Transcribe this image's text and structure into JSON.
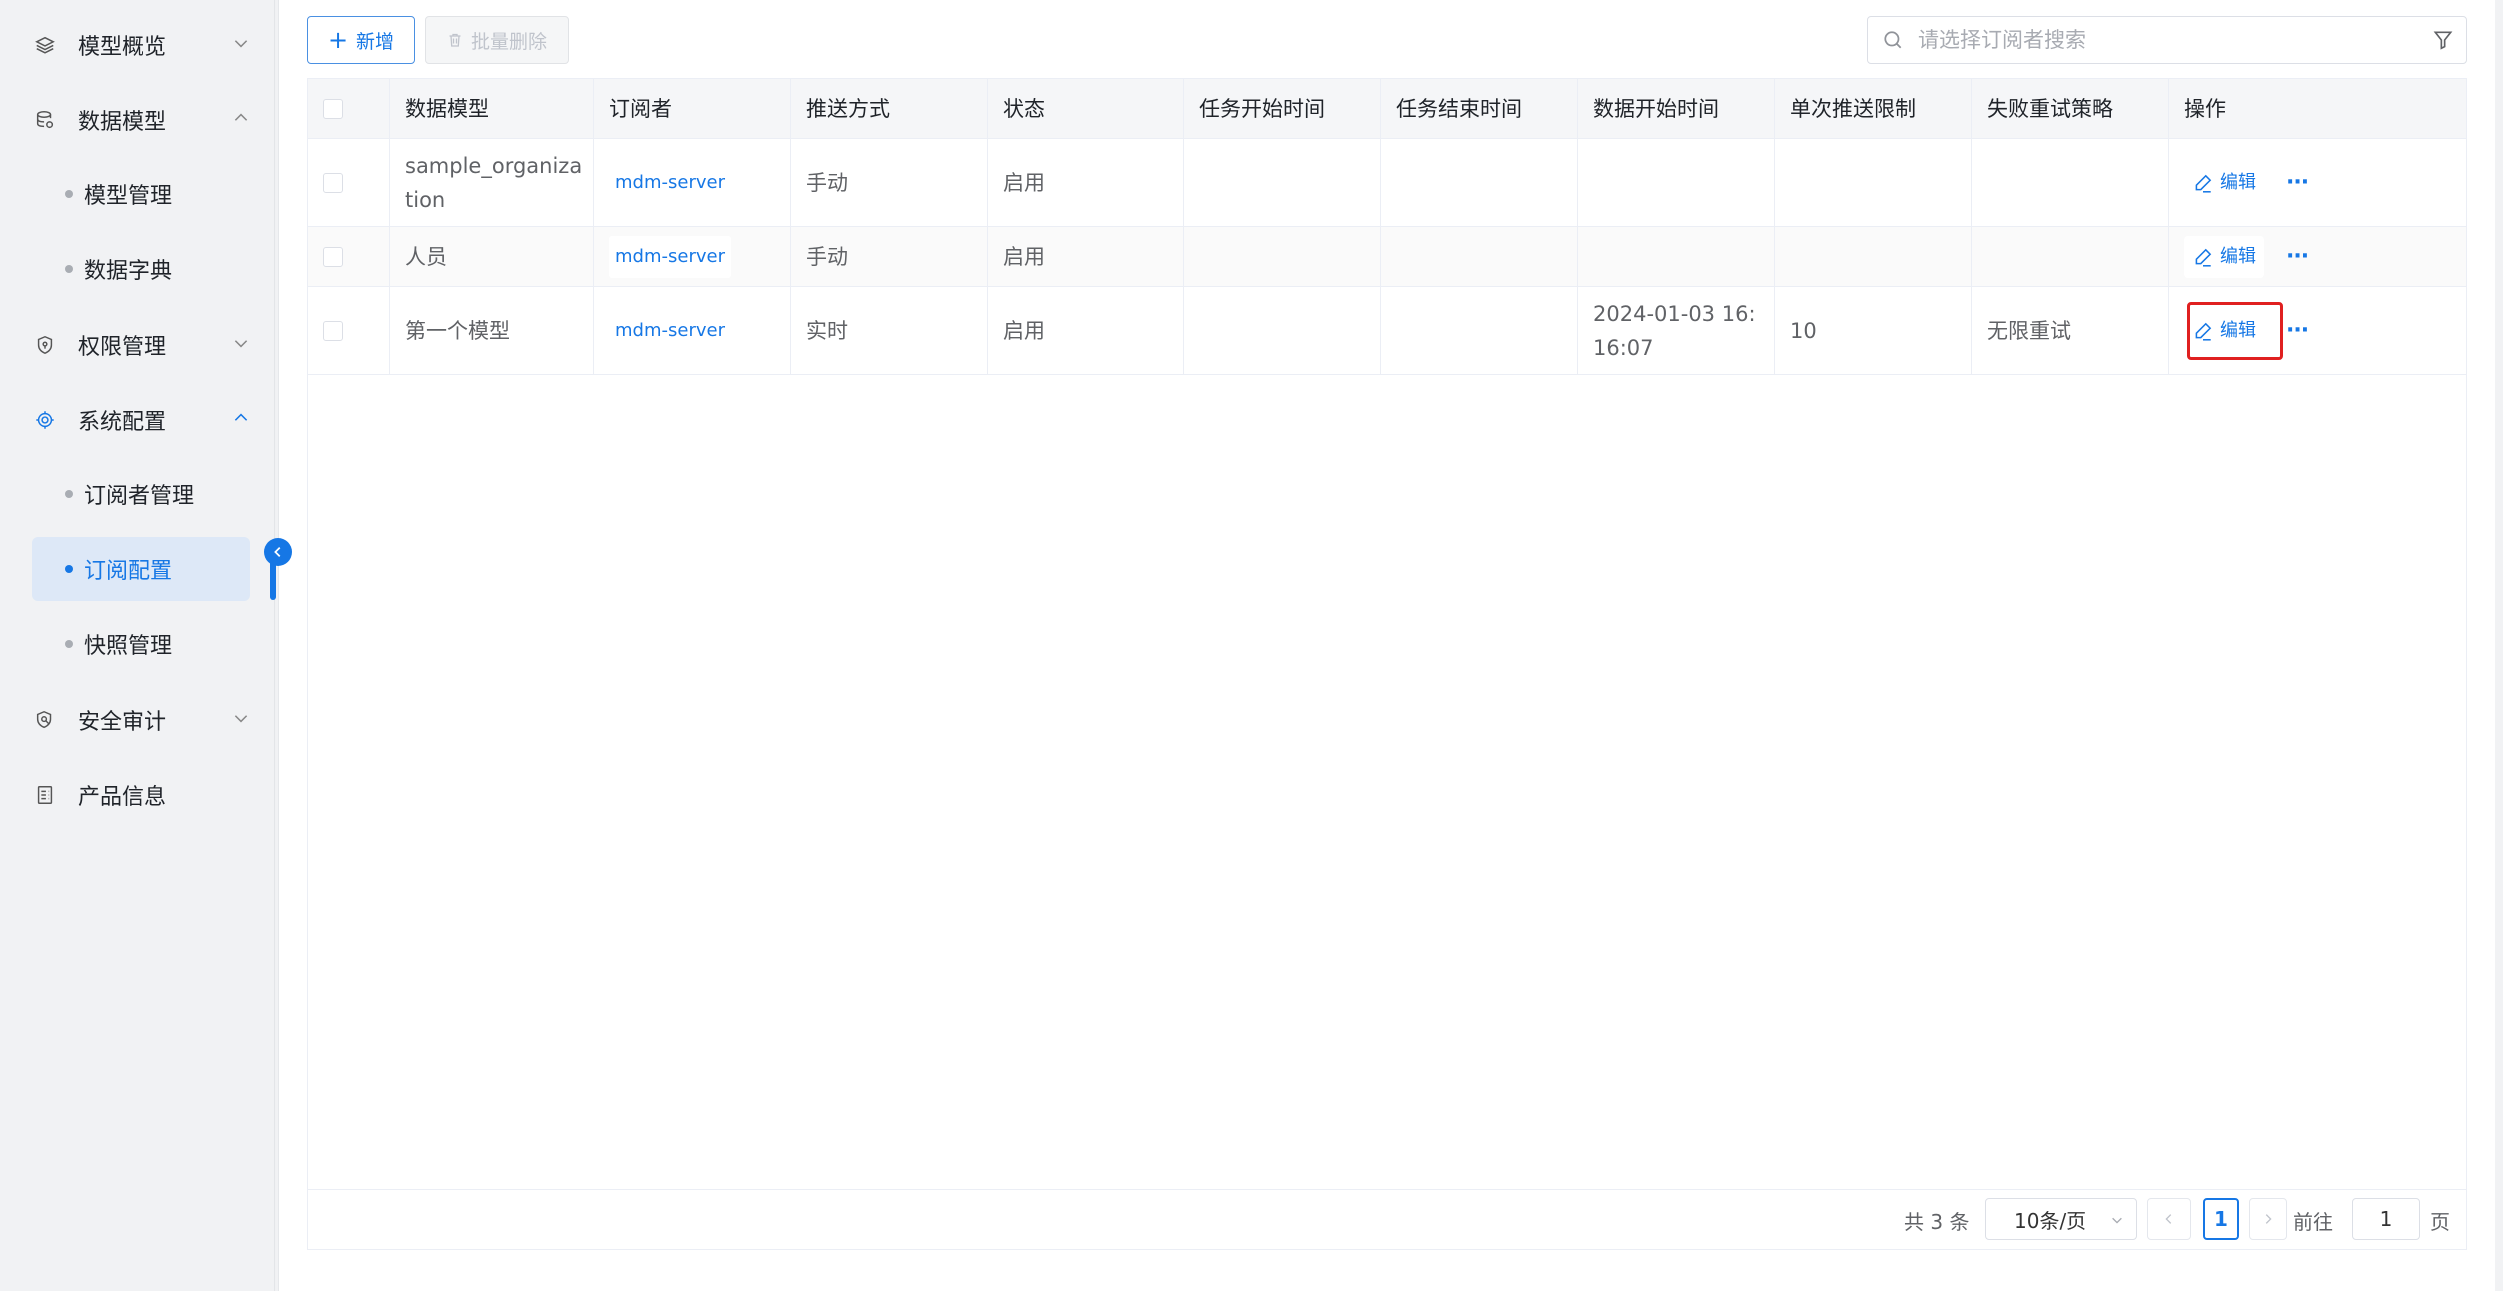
{
  "sidebar": {
    "items": [
      {
        "label": "模型概览",
        "icon": "layers-icon",
        "expanded": false
      },
      {
        "label": "数据模型",
        "icon": "database-icon",
        "expanded": true,
        "children": [
          {
            "label": "模型管理"
          },
          {
            "label": "数据字典"
          }
        ]
      },
      {
        "label": "权限管理",
        "icon": "shield-icon",
        "expanded": false
      },
      {
        "label": "系统配置",
        "icon": "settings-icon",
        "expanded": true,
        "children": [
          {
            "label": "订阅者管理"
          },
          {
            "label": "订阅配置",
            "active": true
          },
          {
            "label": "快照管理"
          }
        ]
      },
      {
        "label": "安全审计",
        "icon": "security-audit-icon",
        "expanded": false
      },
      {
        "label": "产品信息",
        "icon": "document-icon"
      }
    ]
  },
  "toolbar": {
    "add_label": "新增",
    "batch_delete_label": "批量删除",
    "search_placeholder": "请选择订阅者搜索"
  },
  "table": {
    "headers": [
      "数据模型",
      "订阅者",
      "推送方式",
      "状态",
      "任务开始时间",
      "任务结束时间",
      "数据开始时间",
      "单次推送限制",
      "失败重试策略",
      "操作"
    ],
    "rows": [
      {
        "model": "sample_organization",
        "subscriber": "mdm-server",
        "push": "手动",
        "status": "启用",
        "task_start": "",
        "task_end": "",
        "data_start": "",
        "limit": "",
        "retry": "",
        "edit": "编辑"
      },
      {
        "model": "人员",
        "subscriber": "mdm-server",
        "push": "手动",
        "status": "启用",
        "task_start": "",
        "task_end": "",
        "data_start": "",
        "limit": "",
        "retry": "",
        "edit": "编辑"
      },
      {
        "model": "第一个模型",
        "subscriber": "mdm-server",
        "push": "实时",
        "status": "启用",
        "task_start": "",
        "task_end": "",
        "data_start": "2024-01-03 16:16:07",
        "limit": "10",
        "retry": "无限重试",
        "edit": "编辑"
      }
    ]
  },
  "pagination": {
    "total": "共 3 条",
    "page_size": "10条/页",
    "current_page": "1",
    "goto_label": "前往",
    "goto_value": "1",
    "page_unit": "页"
  },
  "colors": {
    "accent": "#1677e5",
    "highlight": "#e02020"
  }
}
